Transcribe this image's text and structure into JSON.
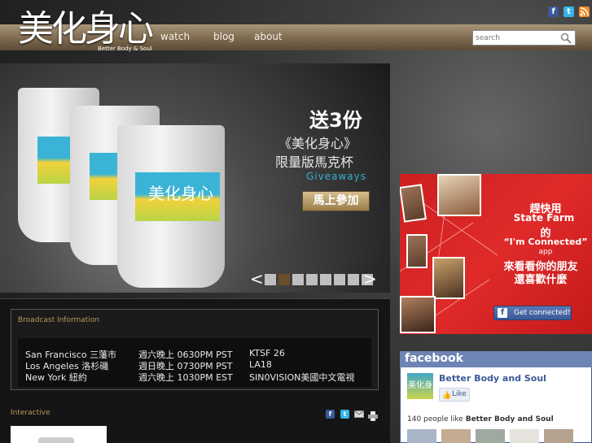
{
  "brand": {
    "logo_chars": "美化身心",
    "tagline": "Better Body & Soul"
  },
  "nav": {
    "items": [
      "watch",
      "blog",
      "about"
    ]
  },
  "search": {
    "placeholder": "search"
  },
  "social_icons": [
    "facebook-icon",
    "twitter-icon",
    "rss-icon"
  ],
  "colors": {
    "accent_gold": "#b79a5a",
    "facebook_blue": "#3b5998",
    "ad_red": "#cc1f20"
  },
  "promo": {
    "title": "送3份",
    "subtitle": "《美化身心》",
    "subtitle2": "限量版馬克杯",
    "giveaways": "Giveaways",
    "join_label": "馬上參加",
    "mug_logo": "美化身心",
    "slide_count": 8,
    "active_slide": 2
  },
  "broadcast": {
    "title": "Broadcast Information",
    "rows": [
      {
        "city": "San Francisco 三藩市",
        "time": "週六晚上 0630PM PST",
        "channel": "KTSF 26"
      },
      {
        "city": "Los Angeles 洛杉磯",
        "time": "週日晚上 0730PM PST",
        "channel": "LA18"
      },
      {
        "city": "New York 紐約",
        "time": "週六晚上 1030PM EST",
        "channel": "SIN0VISION美國中文電視"
      }
    ]
  },
  "interactive": {
    "title": "Interactive",
    "share_icons": [
      "facebook-icon",
      "twitter-icon",
      "email-icon",
      "print-icon"
    ]
  },
  "ad": {
    "line1": "趕快用",
    "brand": "State Farm",
    "line2": "的",
    "line3": "“I'm Connected”",
    "line4": "app",
    "line5": "來看看你的朋友",
    "line6": "還喜歡什麼",
    "button_label": "Get connected!"
  },
  "facebook": {
    "header": "facebook",
    "page_name": "Better Body and Soul",
    "like_label": "Like",
    "count_prefix": "140 people like",
    "count_page": "Better Body and Soul"
  }
}
